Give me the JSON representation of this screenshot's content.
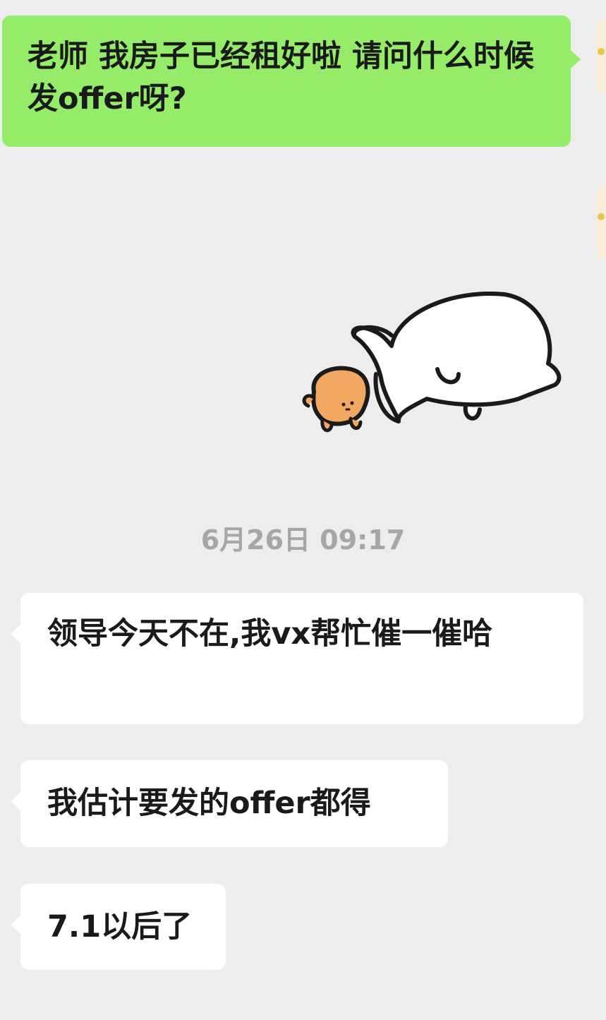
{
  "messages": [
    {
      "direction": "outgoing",
      "text": "老师 我房子已经租好啦 请问什么时候发offer呀?"
    },
    {
      "direction": "outgoing",
      "type": "sticker",
      "sticker": "sleepy-bunny-and-bread-sticker"
    },
    {
      "direction": "incoming",
      "text": "领导今天不在,我vx帮忙催一催哈"
    },
    {
      "direction": "incoming",
      "text": "我估计要发的offer都得"
    },
    {
      "direction": "incoming",
      "text": "7.1以后了"
    }
  ],
  "timestamp": "6月26日 09:17",
  "colors": {
    "background": "#ededed",
    "outgoing_bubble": "#95ec69",
    "incoming_bubble": "#ffffff",
    "timestamp_text": "#a6a6a6"
  }
}
